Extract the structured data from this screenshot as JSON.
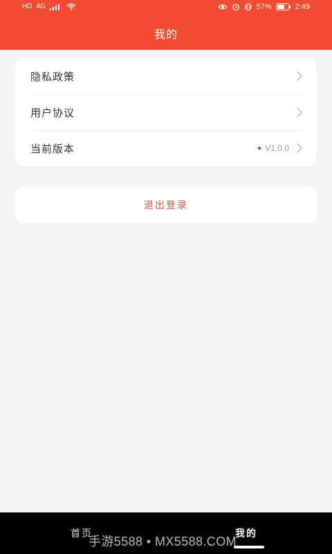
{
  "status_bar": {
    "left_badge": "HD",
    "network": "4G",
    "battery_percent": "57%",
    "time": "2:49",
    "icons": [
      "hd-icon",
      "signal-icon",
      "wifi-icon",
      "eye-icon",
      "alarm-icon",
      "vibrate-icon",
      "battery-icon"
    ]
  },
  "header": {
    "title": "我的",
    "color": "#f24b33"
  },
  "settings": {
    "items": [
      {
        "label": "隐私政策"
      },
      {
        "label": "用户协议"
      },
      {
        "label": "当前版本",
        "value": "V1.0.0"
      }
    ]
  },
  "logout": {
    "label": "退出登录"
  },
  "bottom_nav": {
    "items": [
      {
        "label": "首页"
      },
      {
        "label": "我的"
      }
    ],
    "active": "我的"
  },
  "watermark": {
    "text": "手游5588 • MX5588.COM"
  }
}
